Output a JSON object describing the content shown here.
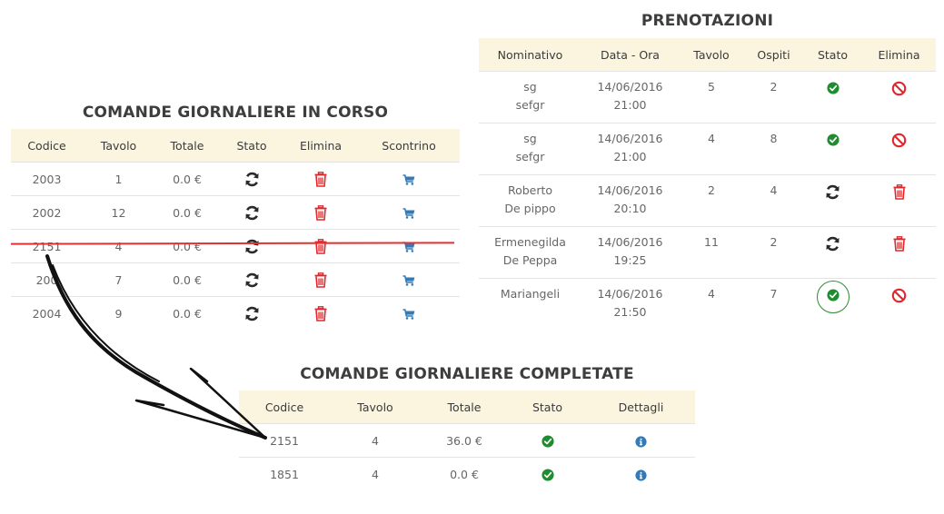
{
  "reservations": {
    "title": "PRENOTAZIONI",
    "headers": [
      "Nominativo",
      "Data - Ora",
      "Tavolo",
      "Ospiti",
      "Stato",
      "Elimina"
    ],
    "rows": [
      {
        "name1": "sg",
        "name2": "sefgr",
        "date": "14/06/2016",
        "time": "21:00",
        "table": "5",
        "guests": "2",
        "status": "check-icon",
        "delete": "ban-icon"
      },
      {
        "name1": "sg",
        "name2": "sefgr",
        "date": "14/06/2016",
        "time": "21:00",
        "table": "4",
        "guests": "8",
        "status": "check-icon",
        "delete": "ban-icon"
      },
      {
        "name1": "Roberto",
        "name2": "De pippo",
        "date": "14/06/2016",
        "time": "20:10",
        "table": "2",
        "guests": "4",
        "status": "refresh-icon",
        "delete": "trash-icon"
      },
      {
        "name1": "Ermenegilda",
        "name2": "De Peppa",
        "date": "14/06/2016",
        "time": "19:25",
        "table": "11",
        "guests": "2",
        "status": "refresh-icon",
        "delete": "trash-icon"
      },
      {
        "name1": "Mariangeli",
        "name2": "",
        "date": "14/06/2016",
        "time": "21:50",
        "table": "4",
        "guests": "7",
        "status": "check-icon",
        "delete": "ban-icon"
      }
    ]
  },
  "daily_orders": {
    "title": "COMANDE GIORNALIERE IN CORSO",
    "headers": [
      "Codice",
      "Tavolo",
      "Totale",
      "Stato",
      "Elimina",
      "Scontrino"
    ],
    "rows": [
      {
        "code": "2003",
        "table": "1",
        "total": "0.0 €"
      },
      {
        "code": "2002",
        "table": "12",
        "total": "0.0 €"
      },
      {
        "code": "2151",
        "table": "4",
        "total": "0.0 €"
      },
      {
        "code": "200",
        "table": "7",
        "total": "0.0 €"
      },
      {
        "code": "2004",
        "table": "9",
        "total": "0.0 €"
      }
    ]
  },
  "completed_orders": {
    "title": "COMANDE GIORNALIERE COMPLETATE",
    "headers": [
      "Codice",
      "Tavolo",
      "Totale",
      "Stato",
      "Dettagli"
    ],
    "rows": [
      {
        "code": "2151",
        "table": "4",
        "total": "36.0 €"
      },
      {
        "code": "1851",
        "table": "4",
        "total": "0.0 €"
      }
    ]
  },
  "colors": {
    "header_bg": "#fbf5df",
    "success": "#1e8c2f",
    "danger": "#e0282c",
    "info": "#337ab7",
    "strike": "#e53030"
  }
}
